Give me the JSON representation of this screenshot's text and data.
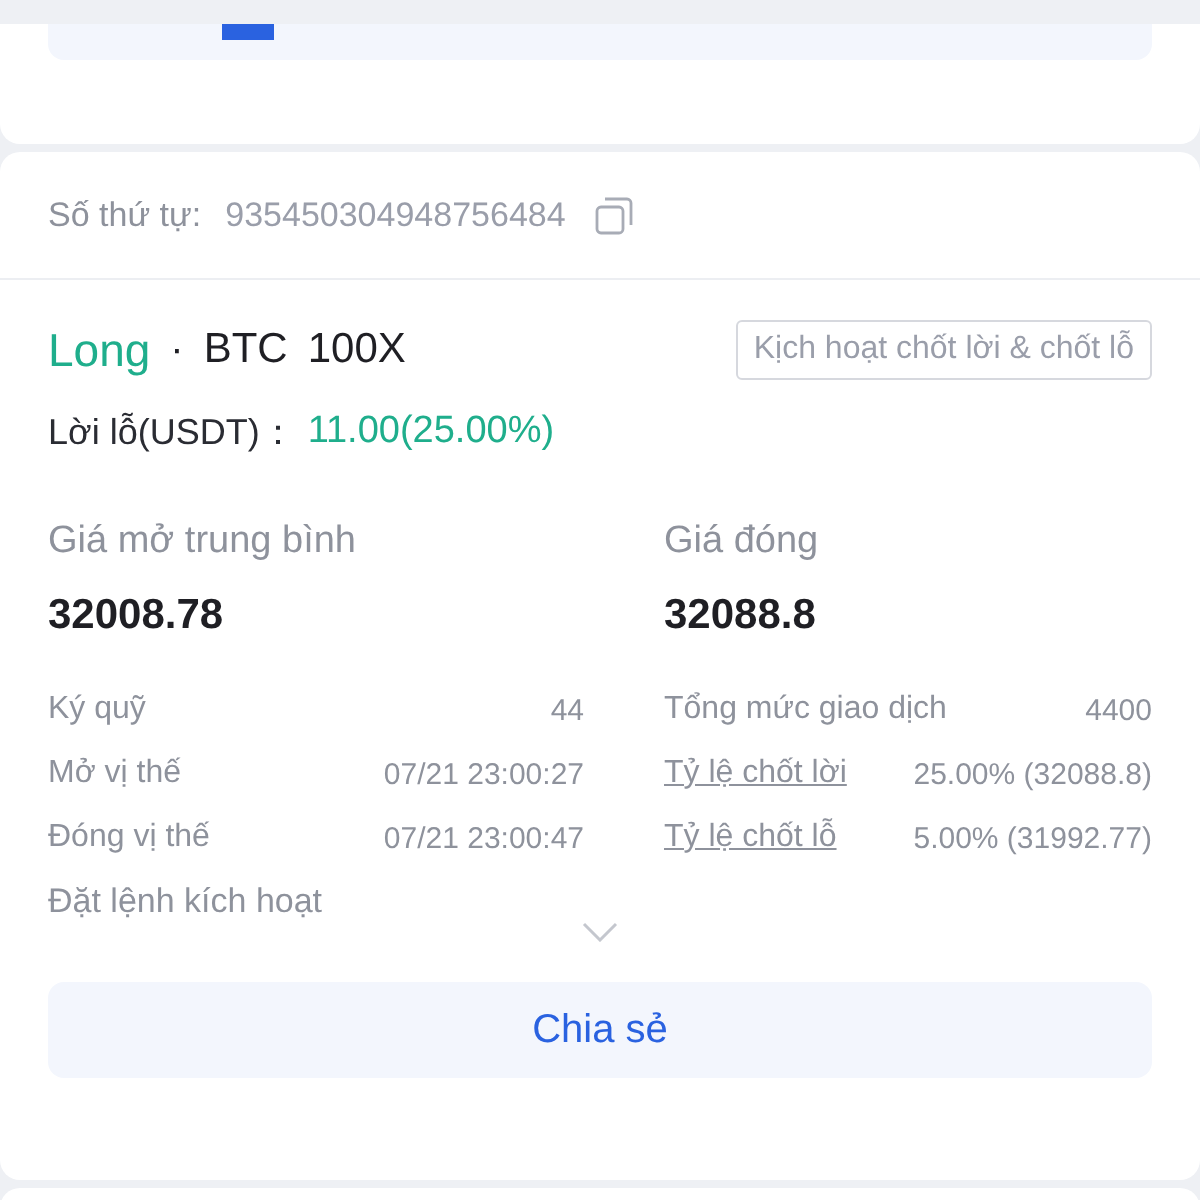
{
  "order": {
    "label": "Số thứ tự:",
    "number": "935450304948756484"
  },
  "position": {
    "side": "Long",
    "kind": "long",
    "separator": "·",
    "symbol": "BTC",
    "leverage": "100X",
    "trigger_tag": "Kịch hoạt chốt lời & chốt lỗ"
  },
  "pnl": {
    "label": "Lời lỗ(USDT)：",
    "value": "11.00(25.00%)",
    "kind": "profit"
  },
  "prices": [
    {
      "label": "Giá mở trung bình",
      "value": "32008.78"
    },
    {
      "label": "Giá đóng",
      "value": "32088.8"
    }
  ],
  "details": [
    [
      {
        "label": "Ký quỹ",
        "value": "44",
        "kind": "plain"
      },
      {
        "label": "Mở vị thế",
        "value": "07/21 23:00:27",
        "kind": "plain"
      },
      {
        "label": "Đóng vị thế",
        "value": "07/21 23:00:47",
        "kind": "plain"
      }
    ],
    [
      {
        "label": "Tổng mức giao dịch",
        "value": "4400",
        "kind": "plain"
      },
      {
        "label": "Tỷ lệ chốt lời",
        "value": "25.00% (32088.8)",
        "kind": "link"
      },
      {
        "label": "Tỷ lệ chốt lỗ",
        "value": "5.00% (31992.77)",
        "kind": "link"
      }
    ]
  ],
  "trigger_order": {
    "label": "Đặt lệnh kích hoạt",
    "expanded": false
  },
  "share_button": "Chia sẻ"
}
